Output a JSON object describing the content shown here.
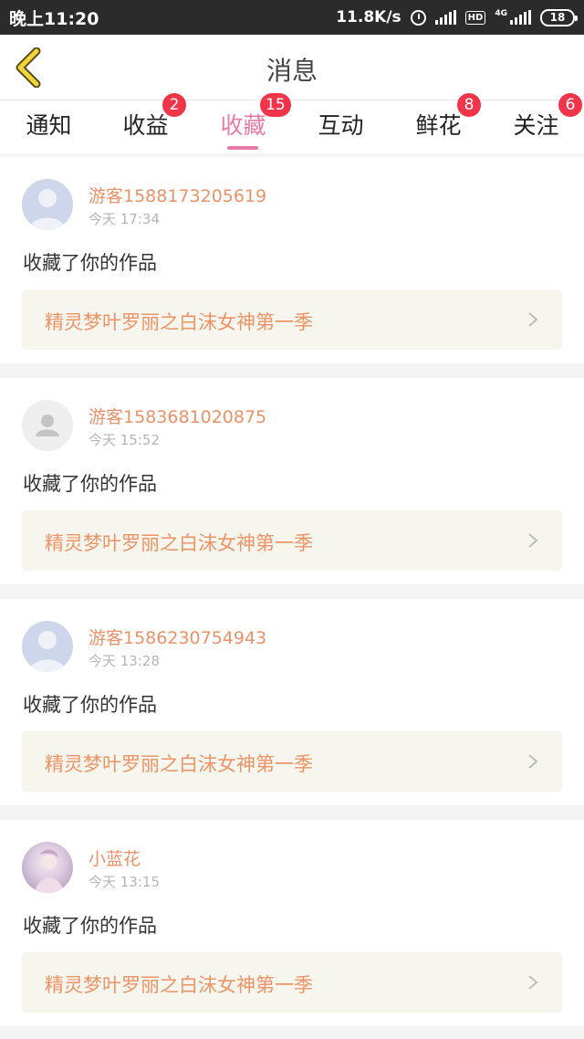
{
  "status_bar": {
    "time": "晚上11:20",
    "net_speed": "11.8K/s",
    "hd": "HD",
    "network": "4G",
    "battery": "18"
  },
  "nav": {
    "title": "消息"
  },
  "tabs": [
    {
      "label": "通知",
      "badge": null
    },
    {
      "label": "收益",
      "badge": "2"
    },
    {
      "label": "收藏",
      "badge": "15",
      "active": true
    },
    {
      "label": "互动",
      "badge": null
    },
    {
      "label": "鲜花",
      "badge": "8"
    },
    {
      "label": "关注",
      "badge": "6"
    }
  ],
  "messages": [
    {
      "user": "游客1588173205619",
      "time": "今天 17:34",
      "action": "收藏了你的作品",
      "work": "精灵梦叶罗丽之白沫女神第一季",
      "avatar": "default-blue"
    },
    {
      "user": "游客1583681020875",
      "time": "今天 15:52",
      "action": "收藏了你的作品",
      "work": "精灵梦叶罗丽之白沫女神第一季",
      "avatar": "default-gray"
    },
    {
      "user": "游客1586230754943",
      "time": "今天 13:28",
      "action": "收藏了你的作品",
      "work": "精灵梦叶罗丽之白沫女神第一季",
      "avatar": "default-blue"
    },
    {
      "user": "小蓝花",
      "time": "今天 13:15",
      "action": "收藏了你的作品",
      "work": "精灵梦叶罗丽之白沫女神第一季",
      "avatar": "photo"
    }
  ],
  "colors": {
    "accent": "#e77aa6",
    "badge": "#f0344a",
    "username": "#e8926a",
    "work_title": "#ec9466",
    "work_bg": "#f6f5ee"
  }
}
